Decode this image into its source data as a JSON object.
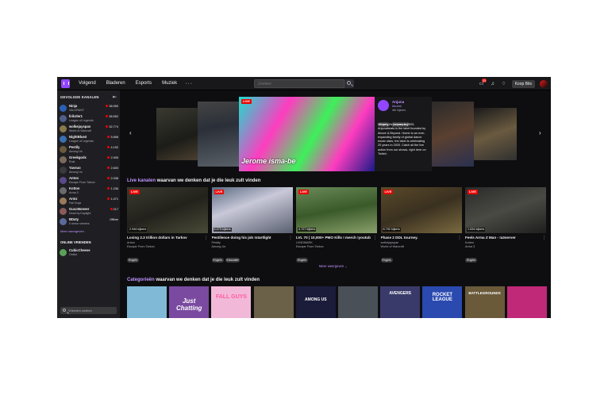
{
  "nav": {
    "links": [
      "Volgend",
      "Bladeren",
      "Esports",
      "Muziek"
    ],
    "more": "···",
    "search_placeholder": "Zoeken",
    "notif_count": "33",
    "bits_label": "Koop Bits"
  },
  "sidebar": {
    "heading": "GEVOLGDE KANALEN",
    "channels": [
      {
        "name": "Ninja",
        "game": "VALORANT",
        "viewers": "38.950",
        "color": "#2b5fb3"
      },
      {
        "name": "lirikzler1",
        "game": "League of Legends",
        "viewers": "38.552",
        "color": "#4f5f8a"
      },
      {
        "name": "wolkejayspan",
        "game": "World of Warcraft",
        "viewers": "32.774",
        "color": "#8a7a4a"
      },
      {
        "name": "NightBlue3",
        "game": "League of Legends",
        "viewers": "5.898",
        "color": "#3a6fb0"
      },
      {
        "name": "Pestily",
        "game": "Among Us",
        "viewers": "4.152",
        "color": "#6b5a3a"
      },
      {
        "name": "Greekgodx",
        "game": "Rust",
        "viewers": "2.905",
        "color": "#7a6a5a"
      },
      {
        "name": "Yassuo",
        "game": "Among Us",
        "viewers": "2.600",
        "color": "#3a3a3a"
      },
      {
        "name": "Anton",
        "game": "Escape From Tarkov",
        "viewers": "2.038",
        "color": "#5a4a8a"
      },
      {
        "name": "Kotton",
        "game": "Arma 3",
        "viewers": "1.236",
        "color": "#6a6a6a"
      },
      {
        "name": "Armz",
        "game": "Fall Guys",
        "viewers": "1.071",
        "color": "#9a7a5a"
      },
      {
        "name": "GuccMoneer",
        "game": "Dead by Daylight",
        "viewers": "217",
        "color": "#8a5a5a"
      },
      {
        "name": "BDaty",
        "game": "Il ricevo viewers",
        "viewers": "Offline",
        "color": "#5a6a9a"
      }
    ],
    "more_link": "Meer weergeven",
    "friends_heading": "ONLINE VRIENDEN",
    "friend": {
      "name": "CubicCheese",
      "status": "Online"
    },
    "friend_search_placeholder": "Vrienden zoeken"
  },
  "featured": {
    "live": "LIVE",
    "logo_text": "Jerome isma-be",
    "channel": "Anjuna",
    "category": "Muziek",
    "viewers": "4th kijkers",
    "tags": [
      "Engels",
      "Verjaarsdag"
    ],
    "description": "Marking its journey in 2005, Anjunabeats is the label founded by Above & Beyond. Home to an ever-expanding family of global dance music stars, the label is celebrating 20 years in 2020. Catch all the live action from our shows, right here on Twitch."
  },
  "live_section": {
    "title_hl": "Live kanalen",
    "title_rest": " waarvan we denken dat je die leuk zult vinden",
    "cards": [
      {
        "live": "LIVE",
        "viewers": "2.946 kijkers",
        "title": "Losing 2.3 trillion dollars in Tarkov",
        "channel": "Anton",
        "game": "Escape From Tarkov",
        "tags": [
          "Engels"
        ]
      },
      {
        "live": "LIVE",
        "viewers": "4.273 kijkers",
        "title": "Pestilence doing his job !startlight",
        "channel": "Pestily",
        "game": "Among Us",
        "tags": [
          "Engels",
          "Educatief"
        ]
      },
      {
        "live": "LIVE",
        "viewers": "4.727 kijkers",
        "title": "LVL 70 | 10,000+ PMO Kills ! merch !youtuber ! Tactical Flamed Action",
        "channel": "LVNDMARK",
        "game": "Escape From Tarkov",
        "tags": [
          "Engels"
        ]
      },
      {
        "live": "LIVE",
        "viewers": "8.792 kijkers",
        "title": "Phase 2 DDL tourney.",
        "channel": "wolkejayspan",
        "game": "World of Warcraft",
        "tags": [
          "Engels"
        ]
      },
      {
        "live": "LIVE",
        "viewers": "1.534 kijkers",
        "title": "Feels Arma Z Man - !a3server",
        "channel": "Kotton",
        "game": "Arma 3",
        "tags": [
          "Engels"
        ]
      }
    ],
    "show_more": "Meer weergeven"
  },
  "categories_section": {
    "title_hl": "Categorieën",
    "title_rest": " waarvan we denken dat je die leuk zult vinden",
    "items": [
      {
        "label": "",
        "bg": "#7fb9d6"
      },
      {
        "label": "Just Chatting",
        "bg": "#7a4aa0"
      },
      {
        "label": "FALL GUYS",
        "bg": "#f2b8d8"
      },
      {
        "label": "",
        "bg": "#6b6048"
      },
      {
        "label": "AMONG US",
        "bg": "#1b1b3a"
      },
      {
        "label": "",
        "bg": "#4a5058"
      },
      {
        "label": "AVENGERS",
        "bg": "#3a3a6a"
      },
      {
        "label": "ROCKET LEAGUE",
        "bg": "#2a4ab0"
      },
      {
        "label": "BATTLEGROUNDS",
        "bg": "#6a5a3a"
      },
      {
        "label": "",
        "bg": "#c02878"
      }
    ]
  }
}
